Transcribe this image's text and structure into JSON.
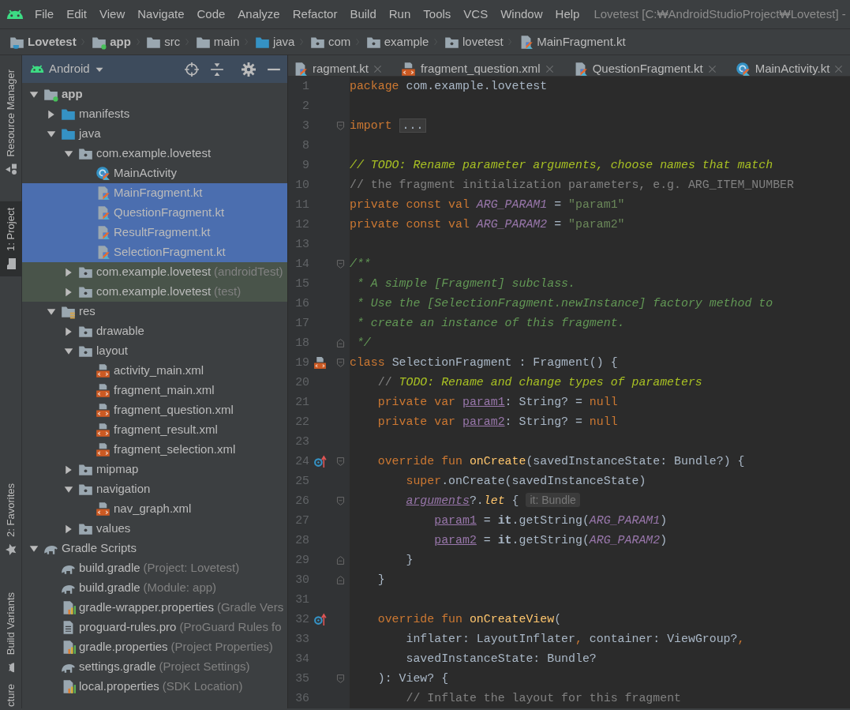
{
  "menu_bar": {
    "items": [
      "File",
      "Edit",
      "View",
      "Navigate",
      "Code",
      "Analyze",
      "Refactor",
      "Build",
      "Run",
      "Tools",
      "VCS",
      "Window",
      "Help"
    ],
    "title": "Lovetest [C:₩AndroidStudioProject₩Lovetest] -"
  },
  "breadcrumb": [
    {
      "label": "Lovetest",
      "kind": "project"
    },
    {
      "label": "app",
      "kind": "module"
    },
    {
      "label": "src",
      "kind": "folder"
    },
    {
      "label": "main",
      "kind": "folder"
    },
    {
      "label": "java",
      "kind": "source-folder"
    },
    {
      "label": "com",
      "kind": "package"
    },
    {
      "label": "example",
      "kind": "package"
    },
    {
      "label": "lovetest",
      "kind": "package"
    },
    {
      "label": "MainFragment.kt",
      "kind": "kotlin-file"
    }
  ],
  "tool_strip": [
    {
      "label": "Resource Manager",
      "kind": "resource",
      "selected": false
    },
    {
      "label": "1: Project",
      "kind": "project",
      "selected": true
    },
    {
      "label": "2: Favorites",
      "kind": "favorites",
      "selected": false
    },
    {
      "label": "Build Variants",
      "kind": "build-variants",
      "selected": false
    },
    {
      "label": "cture",
      "kind": "structure",
      "selected": false
    }
  ],
  "project_panel": {
    "view": "Android",
    "tree": [
      {
        "label": "app",
        "kind": "module",
        "expanded": true,
        "selected": false,
        "children": [
          {
            "label": "manifests",
            "kind": "source-folder",
            "expanded": false,
            "selected": false
          },
          {
            "label": "java",
            "kind": "source-folder",
            "expanded": true,
            "selected": false,
            "children": [
              {
                "label": "com.example.lovetest",
                "kind": "package",
                "expanded": true,
                "selected": false,
                "children": [
                  {
                    "label": "MainActivity",
                    "kind": "kotlin-class",
                    "selected": false
                  },
                  {
                    "label": "MainFragment.kt",
                    "kind": "kotlin-file",
                    "selected": true
                  },
                  {
                    "label": "QuestionFragment.kt",
                    "kind": "kotlin-file",
                    "selected": true
                  },
                  {
                    "label": "ResultFragment.kt",
                    "kind": "kotlin-file",
                    "selected": true
                  },
                  {
                    "label": "SelectionFragment.kt",
                    "kind": "kotlin-file",
                    "selected": true
                  }
                ]
              },
              {
                "label": "com.example.lovetest",
                "note": "(androidTest)",
                "test_scope": true,
                "kind": "package",
                "expanded": false,
                "selected": false
              },
              {
                "label": "com.example.lovetest",
                "note": "(test)",
                "test_scope": true,
                "kind": "package",
                "expanded": false,
                "selected": false
              }
            ]
          },
          {
            "label": "res",
            "kind": "res-folder",
            "expanded": true,
            "selected": false,
            "children": [
              {
                "label": "drawable",
                "kind": "package",
                "expanded": false,
                "selected": false
              },
              {
                "label": "layout",
                "kind": "package",
                "expanded": true,
                "selected": false,
                "children": [
                  {
                    "label": "activity_main.xml",
                    "kind": "xml-file",
                    "selected": false
                  },
                  {
                    "label": "fragment_main.xml",
                    "kind": "xml-file",
                    "selected": false
                  },
                  {
                    "label": "fragment_question.xml",
                    "kind": "xml-file",
                    "selected": false
                  },
                  {
                    "label": "fragment_result.xml",
                    "kind": "xml-file",
                    "selected": false
                  },
                  {
                    "label": "fragment_selection.xml",
                    "kind": "xml-file",
                    "selected": false
                  }
                ]
              },
              {
                "label": "mipmap",
                "kind": "package",
                "expanded": false,
                "selected": false
              },
              {
                "label": "navigation",
                "kind": "package",
                "expanded": true,
                "selected": false,
                "children": [
                  {
                    "label": "nav_graph.xml",
                    "kind": "xml-file",
                    "selected": false
                  }
                ]
              },
              {
                "label": "values",
                "kind": "package",
                "expanded": false,
                "selected": false
              }
            ]
          }
        ]
      },
      {
        "label": "Gradle Scripts",
        "kind": "gradle",
        "expanded": true,
        "selected": false,
        "children": [
          {
            "label": "build.gradle",
            "note": "(Project: Lovetest)",
            "kind": "gradle",
            "selected": false
          },
          {
            "label": "build.gradle",
            "note": "(Module: app)",
            "kind": "gradle",
            "selected": false
          },
          {
            "label": "gradle-wrapper.properties",
            "note": "(Gradle Vers",
            "kind": "properties",
            "selected": false
          },
          {
            "label": "proguard-rules.pro",
            "note": "(ProGuard Rules fo",
            "kind": "text-file",
            "selected": false
          },
          {
            "label": "gradle.properties",
            "note": "(Project Properties)",
            "kind": "properties",
            "selected": false
          },
          {
            "label": "settings.gradle",
            "note": "(Project Settings)",
            "kind": "gradle",
            "selected": false
          },
          {
            "label": "local.properties",
            "note": "(SDK Location)",
            "kind": "properties",
            "selected": false
          }
        ]
      }
    ]
  },
  "editor_tabs": [
    {
      "label": "ragment.kt",
      "kind": "kotlin-file"
    },
    {
      "label": "fragment_question.xml",
      "kind": "xml-file"
    },
    {
      "label": "QuestionFragment.kt",
      "kind": "kotlin-file"
    },
    {
      "label": "MainActivity.kt",
      "kind": "kotlin-class"
    }
  ],
  "editor": {
    "lines": [
      {
        "number": "1",
        "tokens": [
          {
            "text": "package ",
            "kind": "kw"
          },
          {
            "text": "com.example.lovetest",
            "kind": "plain"
          }
        ]
      },
      {
        "number": "2"
      },
      {
        "number": "3",
        "fold_start": true,
        "tokens": [
          {
            "text": "import ",
            "kind": "kw"
          },
          {
            "text": "...",
            "kind": "folded"
          }
        ]
      },
      {
        "number": "8"
      },
      {
        "number": "9",
        "tokens": [
          {
            "text": "// TODO: Rename parameter arguments, choose names that match",
            "kind": "todo"
          }
        ]
      },
      {
        "number": "10",
        "tokens": [
          {
            "text": "// the fragment initialization parameters, e.g. ARG_ITEM_NUMBER",
            "kind": "cmt"
          }
        ]
      },
      {
        "number": "11",
        "tokens": [
          {
            "text": "private const val ",
            "kind": "kw"
          },
          {
            "text": "ARG_PARAM1",
            "kind": "const"
          },
          {
            "text": " = ",
            "kind": "plain"
          },
          {
            "text": "\"param1\"",
            "kind": "str"
          }
        ]
      },
      {
        "number": "12",
        "tokens": [
          {
            "text": "private const val ",
            "kind": "kw"
          },
          {
            "text": "ARG_PARAM2",
            "kind": "const"
          },
          {
            "text": " = ",
            "kind": "plain"
          },
          {
            "text": "\"param2\"",
            "kind": "str"
          }
        ]
      },
      {
        "number": "13"
      },
      {
        "number": "14",
        "fold_start": true,
        "tokens": [
          {
            "text": "/**",
            "kind": "doc"
          }
        ]
      },
      {
        "number": "15",
        "tokens": [
          {
            "text": " * A simple [Fragment] subclass.",
            "kind": "doc"
          }
        ]
      },
      {
        "number": "16",
        "tokens": [
          {
            "text": " * Use the [SelectionFragment.newInstance] factory method to",
            "kind": "doc"
          }
        ]
      },
      {
        "number": "17",
        "tokens": [
          {
            "text": " * create an instance of this fragment.",
            "kind": "doc"
          }
        ]
      },
      {
        "number": "18",
        "fold_end": true,
        "tokens": [
          {
            "text": " */",
            "kind": "doc"
          }
        ]
      },
      {
        "number": "19",
        "fold_start": true,
        "gutter": {
          "kind": "layout"
        },
        "tokens": [
          {
            "text": "class ",
            "kind": "kw"
          },
          {
            "text": "SelectionFragment : Fragment() {",
            "kind": "plain"
          }
        ]
      },
      {
        "number": "20",
        "tokens": [
          {
            "text": "    // ",
            "kind": "cmt"
          },
          {
            "text": "TODO: Rename and change types of parameters",
            "kind": "todo"
          }
        ]
      },
      {
        "number": "21",
        "tokens": [
          {
            "text": "    private var ",
            "kind": "kw"
          },
          {
            "text": "param1",
            "kind": "prop"
          },
          {
            "text": ": String? = ",
            "kind": "plain"
          },
          {
            "text": "null",
            "kind": "kw"
          }
        ]
      },
      {
        "number": "22",
        "tokens": [
          {
            "text": "    private var ",
            "kind": "kw"
          },
          {
            "text": "param2",
            "kind": "prop"
          },
          {
            "text": ": String? = ",
            "kind": "plain"
          },
          {
            "text": "null",
            "kind": "kw"
          }
        ]
      },
      {
        "number": "23"
      },
      {
        "number": "24",
        "fold_start": true,
        "gutter": {
          "kind": "override"
        },
        "tokens": [
          {
            "text": "    override fun ",
            "kind": "kw"
          },
          {
            "text": "onCreate",
            "kind": "fn"
          },
          {
            "text": "(savedInstanceState: Bundle?) {",
            "kind": "plain"
          }
        ]
      },
      {
        "number": "25",
        "tokens": [
          {
            "text": "        super",
            "kind": "kw"
          },
          {
            "text": ".onCreate(savedInstanceState)",
            "kind": "plain"
          }
        ]
      },
      {
        "number": "26",
        "fold_start": true,
        "tokens": [
          {
            "text": "        arguments",
            "kind": "prop-italic"
          },
          {
            "text": "?.",
            "kind": "plain"
          },
          {
            "text": "let",
            "kind": "fn-italic"
          },
          {
            "text": " { ",
            "kind": "plain"
          },
          {
            "text": "it: Bundle",
            "kind": "hint"
          }
        ]
      },
      {
        "number": "27",
        "tokens": [
          {
            "text": "            param1",
            "kind": "prop"
          },
          {
            "text": " = ",
            "kind": "plain"
          },
          {
            "text": "it",
            "kind": "bold"
          },
          {
            "text": ".getString(",
            "kind": "plain"
          },
          {
            "text": "ARG_PARAM1",
            "kind": "const"
          },
          {
            "text": ")",
            "kind": "plain"
          }
        ]
      },
      {
        "number": "28",
        "tokens": [
          {
            "text": "            param2",
            "kind": "prop"
          },
          {
            "text": " = ",
            "kind": "plain"
          },
          {
            "text": "it",
            "kind": "bold"
          },
          {
            "text": ".getString(",
            "kind": "plain"
          },
          {
            "text": "ARG_PARAM2",
            "kind": "const"
          },
          {
            "text": ")",
            "kind": "plain"
          }
        ]
      },
      {
        "number": "29",
        "fold_end": true,
        "tokens": [
          {
            "text": "        }",
            "kind": "plain"
          }
        ]
      },
      {
        "number": "30",
        "fold_end": true,
        "tokens": [
          {
            "text": "    }",
            "kind": "plain"
          }
        ]
      },
      {
        "number": "31"
      },
      {
        "number": "32",
        "gutter": {
          "kind": "override"
        },
        "tokens": [
          {
            "text": "    override fun ",
            "kind": "kw"
          },
          {
            "text": "onCreateView",
            "kind": "fn"
          },
          {
            "text": "(",
            "kind": "plain"
          }
        ]
      },
      {
        "number": "33",
        "tokens": [
          {
            "text": "        inflater: LayoutInflater",
            "kind": "plain"
          },
          {
            "text": ", ",
            "kind": "kw"
          },
          {
            "text": "container: ViewGroup?",
            "kind": "plain"
          },
          {
            "text": ",",
            "kind": "kw"
          }
        ]
      },
      {
        "number": "34",
        "tokens": [
          {
            "text": "        savedInstanceState: Bundle?",
            "kind": "plain"
          }
        ]
      },
      {
        "number": "35",
        "fold_start": true,
        "tokens": [
          {
            "text": "    ): View? {",
            "kind": "plain"
          }
        ]
      },
      {
        "number": "36",
        "tokens": [
          {
            "text": "        // Inflate the layout for this fragment",
            "kind": "cmt"
          }
        ]
      }
    ]
  }
}
